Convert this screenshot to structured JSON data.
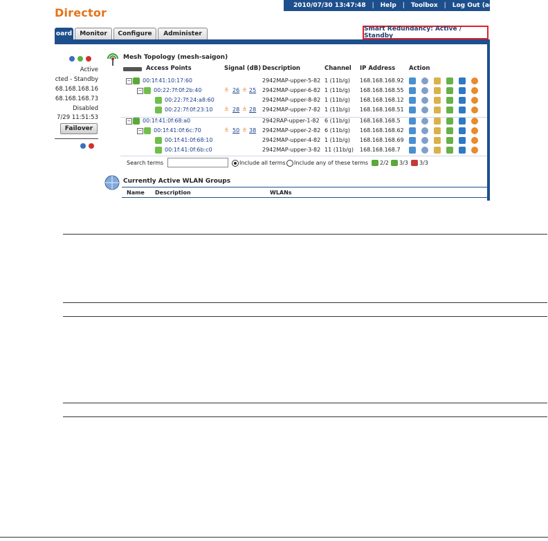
{
  "header": {
    "brand": "Director",
    "datetime": "2010/07/30  13:47:48",
    "links": [
      "Help",
      "Toolbox",
      "Log Out (admin)"
    ],
    "separator": "|"
  },
  "tabs": [
    "oard",
    "Monitor",
    "Configure",
    "Administer"
  ],
  "smart_redundancy": "Smart Redundancy: Active / Standby",
  "left_panel": {
    "status": "Active",
    "connection": "cted - Standby",
    "ip1": "68.168.168.16",
    "ip2": "68.168.168.73",
    "state": "Disabled",
    "time": "7/29  11:51:53",
    "failover_label": "Failover"
  },
  "mesh": {
    "title": "Mesh Topology (mesh-saigon)",
    "columns": [
      "Access Points",
      "Signal (dB)",
      "Description",
      "Channel",
      "IP Address",
      "Action"
    ],
    "rows": [
      {
        "mac": "00:1f:41:10:17:60",
        "sig1": "",
        "sig2": "",
        "desc": "2942MAP-upper-5-82",
        "channel": "1 (11b/g)",
        "ip": "168.168.168.92"
      },
      {
        "mac": "00:22:7f:0f:2b:40",
        "sig1": "26",
        "sig2": "25",
        "desc": "2942MAP-upper-6-82",
        "channel": "1 (11b/g)",
        "ip": "168.168.168.55"
      },
      {
        "mac": "00:22:7f:24:a8:60",
        "sig1": "",
        "sig2": "",
        "desc": "2942MAP-upper-8-82",
        "channel": "1 (11b/g)",
        "ip": "168.168.168.12"
      },
      {
        "mac": "00:22:7f:0f:23:10",
        "sig1": "28",
        "sig2": "28",
        "desc": "2942MAP-upper-7-82",
        "channel": "1 (11b/g)",
        "ip": "168.168.168.51"
      },
      {
        "mac": "00:1f:41:0f:68:a0",
        "sig1": "",
        "sig2": "",
        "desc": "2942RAP-upper-1-82",
        "channel": "6 (11b/g)",
        "ip": "168.168.168.5"
      },
      {
        "mac": "00:1f:41:0f:6c:70",
        "sig1": "50",
        "sig2": "38",
        "desc": "2942MAP-upper-2-82",
        "channel": "6 (11b/g)",
        "ip": "168.168.168.62"
      },
      {
        "mac": "00:1f:41:0f:68:10",
        "sig1": "",
        "sig2": "",
        "desc": "2942MAP-upper-4-82",
        "channel": "1 (11b/g)",
        "ip": "168.168.168.69"
      },
      {
        "mac": "00:1f:41:0f:6b:c0",
        "sig1": "",
        "sig2": "",
        "desc": "2942MAP-upper-3-82",
        "channel": "11 (11b/g)",
        "ip": "168.168.168.7"
      }
    ],
    "search_label": "Search terms",
    "search_value": "",
    "opt_all": "Include all terms",
    "opt_any": "Include any of these terms",
    "count1": "2/2",
    "count2": "3/3",
    "count3": "3/3"
  },
  "wlan": {
    "title": "Currently Active WLAN Groups",
    "columns": [
      "Name",
      "Description",
      "WLANs"
    ]
  },
  "colors": {
    "brand": "#e5731a",
    "nav": "#1e4f8d",
    "highlight_border": "#e0202a",
    "link": "#1a3f8a"
  }
}
